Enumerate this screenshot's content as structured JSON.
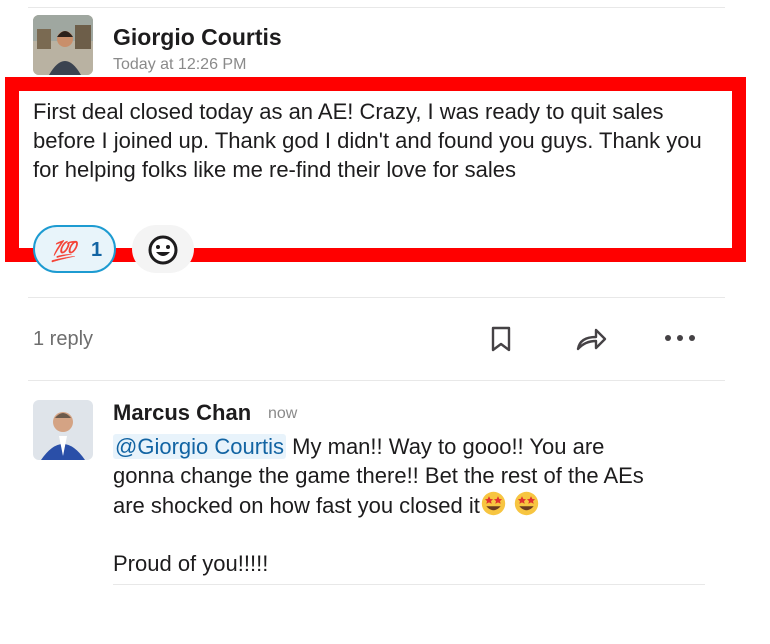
{
  "message1": {
    "author": "Giorgio Courtis",
    "timestamp": "Today at 12:26 PM",
    "text": "First deal closed today as an AE!  Crazy, I was ready to quit sales before I joined up.  Thank god I didn't and found you guys.  Thank you for helping folks like me re-find their love for sales",
    "reactions": [
      {
        "emoji": "💯",
        "count": "1",
        "icon": "hundred-points-icon",
        "selected": true
      },
      {
        "emoji": "😀",
        "count": "",
        "icon": "grinning-face-icon",
        "selected": false
      }
    ]
  },
  "thread_bar": {
    "reply_count_label": "1 reply",
    "icons": [
      "bookmark-icon",
      "share-arrow-icon",
      "more-options-icon"
    ]
  },
  "message2": {
    "author": "Marcus Chan",
    "timestamp": "now",
    "mention": "@Giorgio Courtis",
    "text_line1_rest": " My man!! Way to gooo!! You are",
    "text_line2": "gonna change the game there!! Bet the rest of the AEs",
    "text_line3": "are shocked on how fast you closed it",
    "emoji_icon": "star-struck-icon",
    "text_line4": "Proud of you!!!!!"
  },
  "colors": {
    "highlight_border": "#ff0000",
    "mention_text": "#1264a3",
    "mention_bg": "#e8f3fb",
    "reaction_selected_border": "#1d9bd1"
  }
}
